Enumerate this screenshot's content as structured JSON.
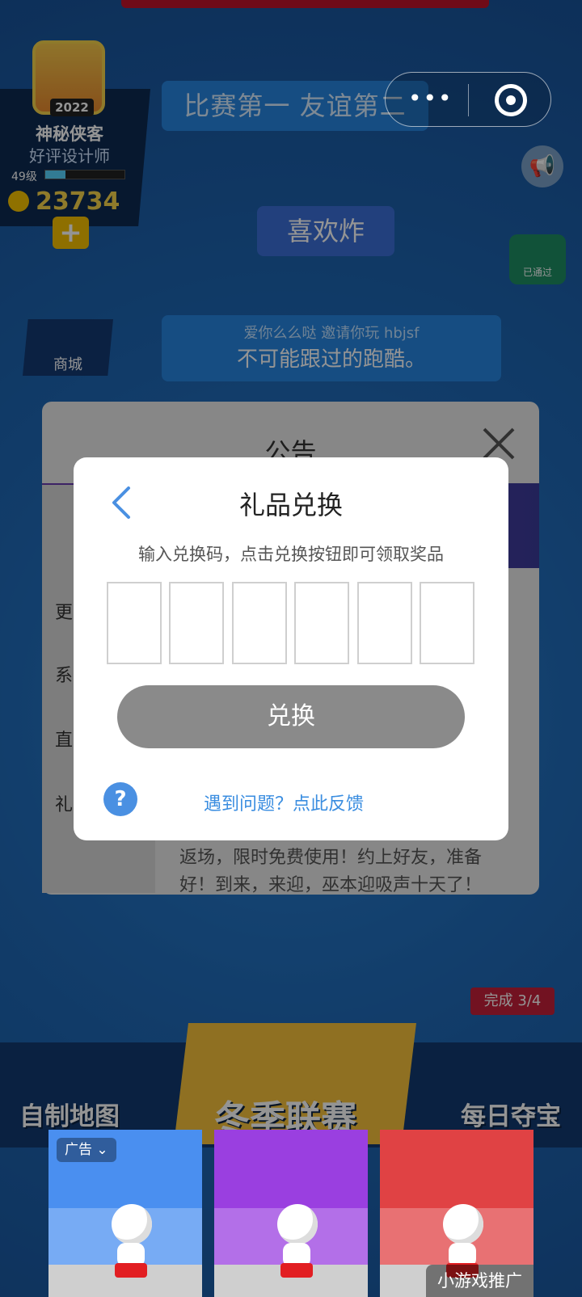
{
  "profile": {
    "avatar_year": "2022",
    "name": "神秘侠客",
    "title": "好评设计师",
    "level": "49级",
    "xp_fraction": 0.25,
    "coins": "23734",
    "add_coins": "+"
  },
  "banners": {
    "banner_1": "比赛第一 友谊第二",
    "banner_2": "喜欢炸",
    "invite_line": "爱你么么哒 邀请你玩 hbjsf",
    "invite_title": "不可能跟过的跑酷。"
  },
  "capsule": {
    "more": "•••"
  },
  "side": {
    "badge_done": "已通过",
    "shop_label": "商城"
  },
  "notice": {
    "title": "公告",
    "side_items": [
      "更",
      "系",
      "直",
      "礼"
    ],
    "body_line1": "返场，限时免费使用！约上好友，准备",
    "body_line2": "好！到来，来迎，巫本迎吸声十天了！"
  },
  "bottom": {
    "mode_left": "自制地图",
    "mode_center": "冬季联赛",
    "mode_right": "每日夺宝",
    "progress_tag": "完成 3/4"
  },
  "ad": {
    "label": "广告",
    "promo": "小游戏推广",
    "colors": [
      "#4a8ff0",
      "#9a3fe0",
      "#e04244"
    ]
  },
  "dialog": {
    "title": "礼品兑换",
    "description": "输入兑换码，点击兑换按钮即可领取奖品",
    "code_slots": [
      "",
      "",
      "",
      "",
      "",
      ""
    ],
    "redeem_label": "兑换",
    "help_icon": "?",
    "help_link": "遇到问题？点此反馈"
  },
  "colors": {
    "accent_blue": "#4a90e2",
    "button_disabled": "#8a8a8a"
  }
}
